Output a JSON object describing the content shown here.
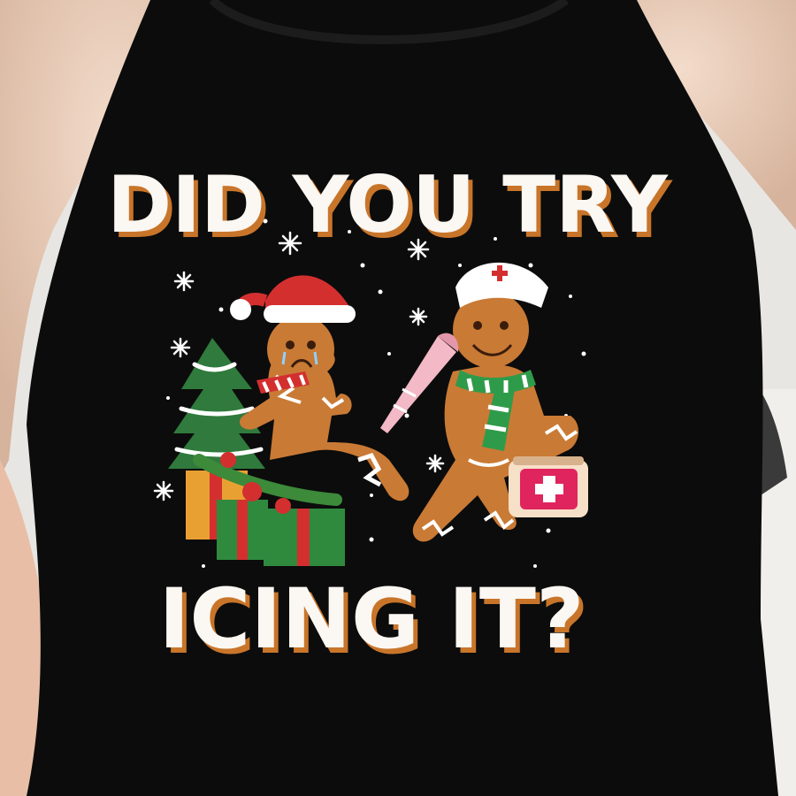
{
  "print": {
    "line1": "DID YOU TRY",
    "line2": "ICING IT?"
  },
  "colors": {
    "shirt": "#0c0c0c",
    "text_fill": "#fbf7f2",
    "text_shadow": "#c8752a",
    "gingerbread": "#c97a35",
    "icing": "#ffffff",
    "santa_red": "#d42f2f",
    "scarf_green": "#2e9b4a",
    "tree_green": "#2f7a3c",
    "hair": "#e9cdbb",
    "background_wall": "#e8e6e3"
  },
  "icons": [
    "snowflake-icon",
    "red-cross-icon",
    "santa-hat-icon",
    "nurse-cap-icon",
    "christmas-tree-icon",
    "gift-box-icon",
    "piping-bag-icon",
    "first-aid-kit-icon"
  ]
}
